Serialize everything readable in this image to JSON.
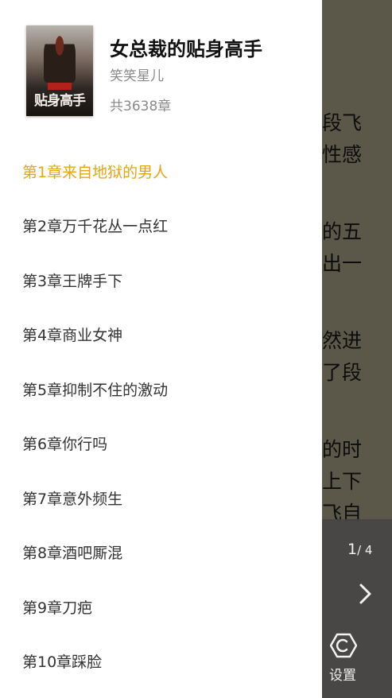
{
  "reader": {
    "lines": [
      "段飞",
      "性感",
      "的五",
      "出一",
      "然进",
      "了段",
      "的时",
      "上下",
      "飞自"
    ],
    "page_current": "1",
    "page_total": "/ 4",
    "settings_label": "设置"
  },
  "book": {
    "title": "女总裁的贴身高手",
    "author": "笑笑星儿",
    "chapter_count": "共3638章",
    "cover_text": "贴身高手"
  },
  "chapters": [
    "第1章来自地狱的男人",
    "第2章万千花丛一点红",
    "第3章王牌手下",
    "第4章商业女神",
    "第5章抑制不住的激动",
    "第6章你行吗",
    "第7章意外频生",
    "第8章酒吧厮混",
    "第9章刀疤",
    "第10章踩脸"
  ],
  "active_chapter_index": 0,
  "colors": {
    "accent": "#e0a616",
    "chapter_text": "#333333",
    "overlay": "rgba(0,0,0,0.58)"
  }
}
